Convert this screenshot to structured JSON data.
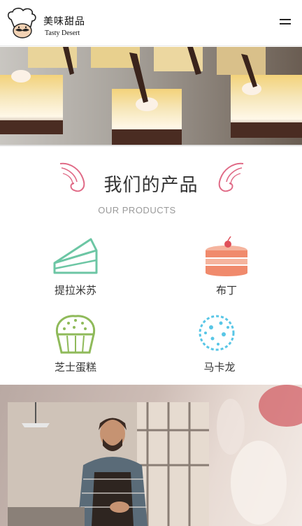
{
  "header": {
    "logo_cn": "美味甜品",
    "logo_en": "Tasty Desert",
    "menu_icon": "hamburger-menu-icon"
  },
  "products": {
    "title": "我们的产品",
    "subtitle": "OUR PRODUCTS",
    "items": [
      {
        "label": "提拉米苏",
        "icon": "cake-slice-icon",
        "color": "#6cc6a4"
      },
      {
        "label": "布丁",
        "icon": "layer-cake-icon",
        "color": "#f08a6c"
      },
      {
        "label": "芝士蛋糕",
        "icon": "cupcake-icon",
        "color": "#8fba5a"
      },
      {
        "label": "马卡龙",
        "icon": "macaron-icon",
        "color": "#58c6e6"
      }
    ]
  },
  "colors": {
    "accent_pink": "#e06a86",
    "title": "#333333",
    "subtitle": "#999999"
  }
}
